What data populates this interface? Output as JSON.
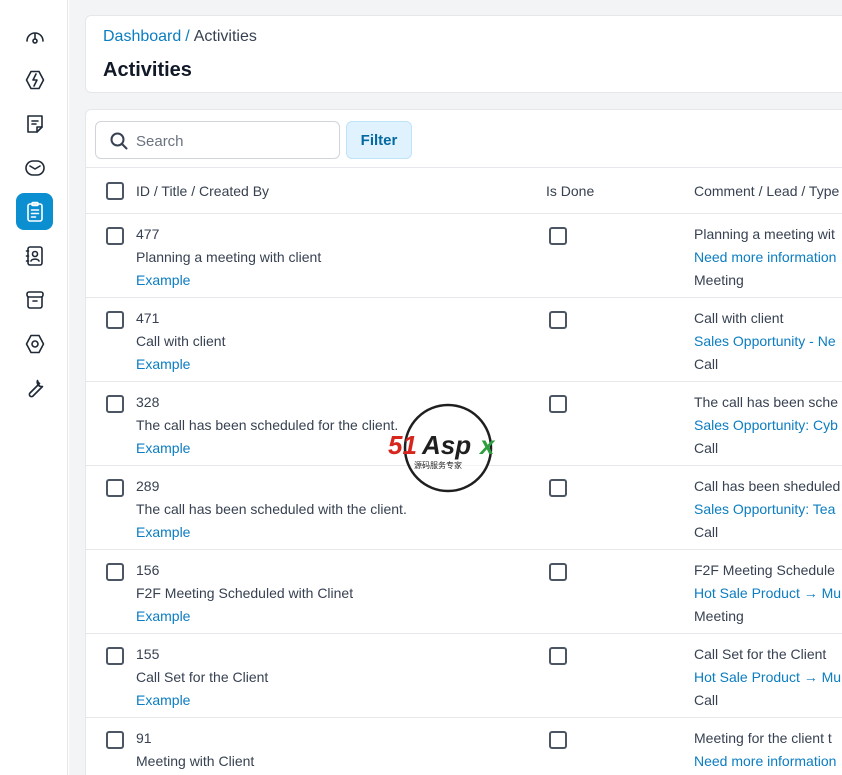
{
  "sidebar": {
    "items": [
      {
        "icon": "dashboard-gauge-icon",
        "active": false
      },
      {
        "icon": "leads-icon",
        "active": false
      },
      {
        "icon": "quotes-icon",
        "active": false
      },
      {
        "icon": "mail-icon",
        "active": false
      },
      {
        "icon": "activities-clipboard-icon",
        "active": true
      },
      {
        "icon": "contacts-book-icon",
        "active": false
      },
      {
        "icon": "products-box-icon",
        "active": false
      },
      {
        "icon": "settings-hexagon-icon",
        "active": false
      },
      {
        "icon": "configuration-wrench-icon",
        "active": false
      }
    ],
    "accent_color": "#0b8fd1"
  },
  "header": {
    "breadcrumb": {
      "parent": "Dashboard",
      "separator": "/",
      "current": "Activities"
    },
    "title": "Activities"
  },
  "toolbar": {
    "search_placeholder": "Search",
    "filter_label": "Filter"
  },
  "table": {
    "columns": [
      "ID / Title / Created By",
      "Is Done",
      "Comment / Lead / Type"
    ],
    "rows": [
      {
        "id": "477",
        "title": "Planning a meeting with client",
        "created_by": "Example",
        "comment": "Planning a meeting wit",
        "lead": "Need more information",
        "type": "Meeting"
      },
      {
        "id": "471",
        "title": "Call with client",
        "created_by": "Example",
        "comment": "Call with client",
        "lead": "Sales Opportunity - Ne",
        "type": "Call"
      },
      {
        "id": "328",
        "title": "The call has been scheduled for the client.",
        "created_by": "Example",
        "comment": "The call has been sche",
        "lead": "Sales Opportunity: Cyb",
        "type": "Call"
      },
      {
        "id": "289",
        "title": "The call has been scheduled with the client.",
        "created_by": "Example",
        "comment": "Call has been sheduled",
        "lead": "Sales Opportunity: Tea",
        "type": "Call"
      },
      {
        "id": "156",
        "title": "F2F Meeting Scheduled with Clinet",
        "created_by": "Example",
        "comment": "F2F Meeting Schedule",
        "lead": "Hot Sale Product → Mu",
        "type": "Meeting"
      },
      {
        "id": "155",
        "title": "Call Set for the Client",
        "created_by": "Example",
        "comment": "Call Set for the Client",
        "lead": "Hot Sale Product → Mu",
        "type": "Call"
      },
      {
        "id": "91",
        "title": "Meeting with Client",
        "created_by": "",
        "comment": "Meeting for the client t",
        "lead": "Need more information",
        "type": ""
      }
    ]
  },
  "watermark": {
    "brand": "51Aspx",
    "subtitle": "源码服务专家"
  }
}
